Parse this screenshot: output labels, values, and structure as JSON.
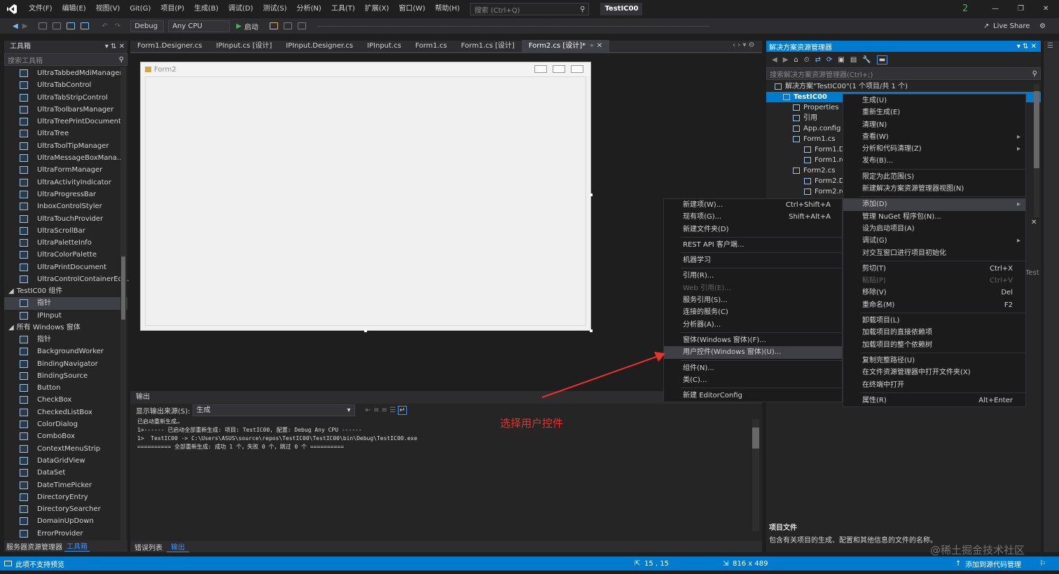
{
  "titlebar": {
    "menus": [
      "文件(F)",
      "编辑(E)",
      "视图(V)",
      "Git(G)",
      "项目(P)",
      "生成(B)",
      "调试(D)",
      "测试(S)",
      "分析(N)",
      "工具(T)",
      "扩展(X)",
      "窗口(W)",
      "帮助(H)"
    ],
    "search_placeholder": "搜索 (Ctrl+Q)",
    "project_name": "TestIC00",
    "notification_count": "2"
  },
  "toolbar": {
    "config": "Debug",
    "platform": "Any CPU",
    "start_label": "启动",
    "live_share": "Live Share"
  },
  "toolbox": {
    "title": "工具箱",
    "search_placeholder": "搜索工具箱",
    "items_top": [
      "UltraTabbedMdiManager",
      "UltraTabControl",
      "UltraTabStripControl",
      "UltraToolbarsManager",
      "UltraTreePrintDocument",
      "UltraTree",
      "UltraToolTipManager",
      "UltraMessageBoxMana...",
      "UltraFormManager",
      "UltraActivityIndicator",
      "UltraProgressBar",
      "InboxControlStyler",
      "UltraTouchProvider",
      "UltraScrollBar",
      "UltraPaletteInfo",
      "UltraColorPalette",
      "UltraPrintDocument",
      "UltraControlContainerEd..."
    ],
    "category_project": "TestIC00 组件",
    "project_items": [
      "指针",
      "IPInput"
    ],
    "category_all": "所有 Windows 窗体",
    "all_items": [
      "指针",
      "BackgroundWorker",
      "BindingNavigator",
      "BindingSource",
      "Button",
      "CheckBox",
      "CheckedListBox",
      "ColorDialog",
      "ComboBox",
      "ContextMenuStrip",
      "DataGridView",
      "DataSet",
      "DateTimePicker",
      "DirectoryEntry",
      "DirectorySearcher",
      "DomainUpDown",
      "ErrorProvider"
    ],
    "bottom_tabs": [
      "服务器资源管理器",
      "工具箱"
    ]
  },
  "doc_tabs": [
    "Form1.Designer.cs",
    "IPInput.cs [设计]",
    "IPInput.Designer.cs",
    "IPInput.cs",
    "Form1.cs",
    "Form1.cs [设计]",
    "Form2.cs [设计]*"
  ],
  "designer": {
    "form_title": "Form2"
  },
  "output": {
    "title": "输出",
    "source_label": "显示输出来源(S):",
    "source_value": "生成",
    "lines": [
      "已启动重新生成…",
      "1>------ 已启动全部重新生成: 项目: TestIC00, 配置: Debug Any CPU ------",
      "1>  TestIC00 -> C:\\Users\\ASUS\\source\\repos\\TestIC00\\TestIC00\\bin\\Debug\\TestIC00.exe",
      "========== 全部重新生成: 成功 1 个，失败 0 个，跳过 0 个 =========="
    ],
    "bottom_tabs": [
      "错误列表",
      "输出"
    ]
  },
  "annotation": "选择用户控件",
  "solution_explorer": {
    "title": "解决方案资源管理器",
    "search_placeholder": "搜索解决方案资源管理器(Ctrl+;)",
    "items": [
      {
        "text": "解决方案\"TestIC00\"(1 个项目/共 1 个)",
        "indent": 12
      },
      {
        "text": "TestIC00",
        "indent": 24,
        "selected": true
      },
      {
        "text": "Properties",
        "indent": 38
      },
      {
        "text": "引用",
        "indent": 38
      },
      {
        "text": "App.config",
        "indent": 38
      },
      {
        "text": "Form1.cs",
        "indent": 38
      },
      {
        "text": "Form1.D",
        "indent": 54
      },
      {
        "text": "Form1.re",
        "indent": 54
      },
      {
        "text": "Form2.cs",
        "indent": 38
      },
      {
        "text": "Form2.D",
        "indent": 54
      },
      {
        "text": "Form2.re",
        "indent": 54
      }
    ],
    "props_title": "项目文件",
    "props_desc": "包含有关项目的生成、配置和其他信息的文件的名称。",
    "side_label": "Test"
  },
  "context_main": [
    {
      "label": "生成(U)"
    },
    {
      "label": "重新生成(E)"
    },
    {
      "label": "清理(N)"
    },
    {
      "label": "查看(W)",
      "arrow": true
    },
    {
      "label": "分析和代码清理(Z)",
      "arrow": true
    },
    {
      "label": "发布(B)..."
    },
    {
      "sep": true
    },
    {
      "label": "限定为此范围(S)"
    },
    {
      "label": "新建解决方案资源管理器视图(N)"
    },
    {
      "sep": true
    },
    {
      "label": "添加(D)",
      "arrow": true,
      "selected": true
    },
    {
      "label": "管理 NuGet 程序包(N)..."
    },
    {
      "label": "设为启动项目(A)"
    },
    {
      "label": "调试(G)",
      "arrow": true
    },
    {
      "label": "对交互窗口进行项目初始化"
    },
    {
      "sep": true
    },
    {
      "label": "剪切(T)",
      "shortcut": "Ctrl+X"
    },
    {
      "label": "粘贴(P)",
      "shortcut": "Ctrl+V",
      "disabled": true
    },
    {
      "label": "移除(V)",
      "shortcut": "Del"
    },
    {
      "label": "重命名(M)",
      "shortcut": "F2"
    },
    {
      "sep": true
    },
    {
      "label": "卸载项目(L)"
    },
    {
      "label": "加载项目的直接依赖项"
    },
    {
      "label": "加载项目的整个依赖树"
    },
    {
      "sep": true
    },
    {
      "label": "复制完整路径(U)"
    },
    {
      "label": "在文件资源管理器中打开文件夹(X)"
    },
    {
      "label": "在终端中打开"
    },
    {
      "sep": true
    },
    {
      "label": "属性(R)",
      "shortcut": "Alt+Enter"
    }
  ],
  "context_add": [
    {
      "label": "新建项(W)...",
      "shortcut": "Ctrl+Shift+A"
    },
    {
      "label": "现有项(G)...",
      "shortcut": "Shift+Alt+A"
    },
    {
      "label": "新建文件夹(D)"
    },
    {
      "sep": true
    },
    {
      "label": "REST API 客户端..."
    },
    {
      "sep": true
    },
    {
      "label": "机器学习"
    },
    {
      "sep": true
    },
    {
      "label": "引用(R)..."
    },
    {
      "label": "Web 引用(E)...",
      "disabled": true
    },
    {
      "label": "服务引用(S)..."
    },
    {
      "label": "连接的服务(C)"
    },
    {
      "label": "分析器(A)..."
    },
    {
      "sep": true
    },
    {
      "label": "窗体(Windows 窗体)(F)..."
    },
    {
      "label": "用户控件(Windows 窗体)(U)...",
      "selected": true
    },
    {
      "sep": true
    },
    {
      "label": "组件(N)..."
    },
    {
      "label": "类(C)..."
    },
    {
      "sep": true
    },
    {
      "label": "新建 EditorConfig"
    }
  ],
  "statusbar": {
    "left": "此项不支持预览",
    "position": "15 , 15",
    "size": "816 x 489",
    "source_control": "添加到源代码管理"
  },
  "watermark": "@稀土掘金技术社区",
  "colors": {
    "accent": "#007acc",
    "bg": "#1e1e1e",
    "panel": "#252526",
    "annotation": "#e8322a"
  }
}
